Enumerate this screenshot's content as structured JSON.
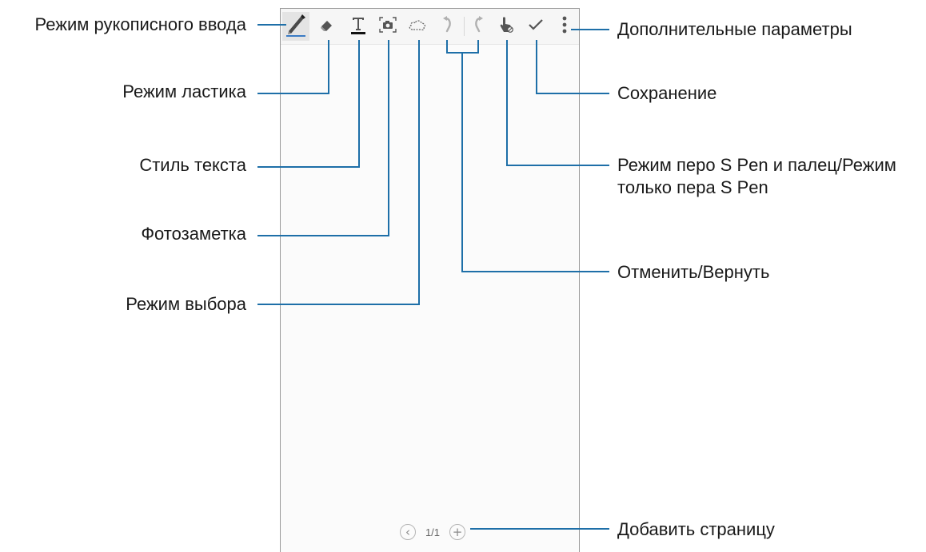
{
  "labels": {
    "handwriting": "Режим рукописного ввода",
    "eraser": "Режим ластика",
    "text_style": "Стиль текста",
    "photo_note": "Фотозаметка",
    "selection": "Режим выбора",
    "more_options": "Дополнительные параметры",
    "save": "Сохранение",
    "pen_mode_line1": "Режим перо S Pen и палец/Режим",
    "pen_mode_line2": "только пера S Pen",
    "undo_redo": "Отменить/Вернуть",
    "add_page": "Добавить страницу"
  },
  "pager": {
    "page_indicator": "1/1"
  },
  "colors": {
    "leader_line": "#1e6fa8",
    "toolbar": "#f6f6f6",
    "frame": "#9a9a9a"
  },
  "toolbar_icons": [
    "pen-icon",
    "eraser-icon",
    "text-icon",
    "camera-icon",
    "cloud-selection-icon",
    "undo-icon",
    "redo-icon",
    "hand-pen-icon",
    "checkmark-icon",
    "more-vertical-icon"
  ]
}
